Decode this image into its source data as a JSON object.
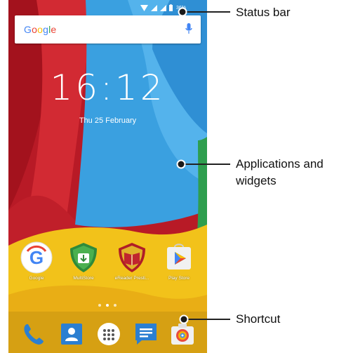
{
  "status_bar": {
    "battery_text": "36%"
  },
  "search": {
    "logo_letters": [
      {
        "char": "G",
        "color": "#4285F4"
      },
      {
        "char": "o",
        "color": "#EA4335"
      },
      {
        "char": "o",
        "color": "#FBBC05"
      },
      {
        "char": "g",
        "color": "#4285F4"
      },
      {
        "char": "l",
        "color": "#34A853"
      },
      {
        "char": "e",
        "color": "#EA4335"
      }
    ]
  },
  "clock": {
    "time": "16:12",
    "date": "Thu 25 February"
  },
  "apps": [
    {
      "label": "Google",
      "icon": "google-app-icon"
    },
    {
      "label": "MultiStore",
      "icon": "multistore-icon"
    },
    {
      "label": "eReader Presti...",
      "icon": "ereader-icon"
    },
    {
      "label": "Play Store",
      "icon": "play-store-icon"
    }
  ],
  "dock": [
    {
      "icon": "phone-icon"
    },
    {
      "icon": "contacts-icon"
    },
    {
      "icon": "app-drawer-icon"
    },
    {
      "icon": "messages-icon"
    },
    {
      "icon": "camera-icon"
    }
  ],
  "callouts": {
    "status_bar": "Status bar",
    "applications_line1": "Applications and",
    "applications_line2": "widgets",
    "shortcut": "Shortcut"
  },
  "colors": {
    "red": "#C8202C",
    "blue": "#3AA0E0",
    "yellow": "#F2C21A",
    "green": "#2E9E4E",
    "callout_line": "#222222"
  }
}
